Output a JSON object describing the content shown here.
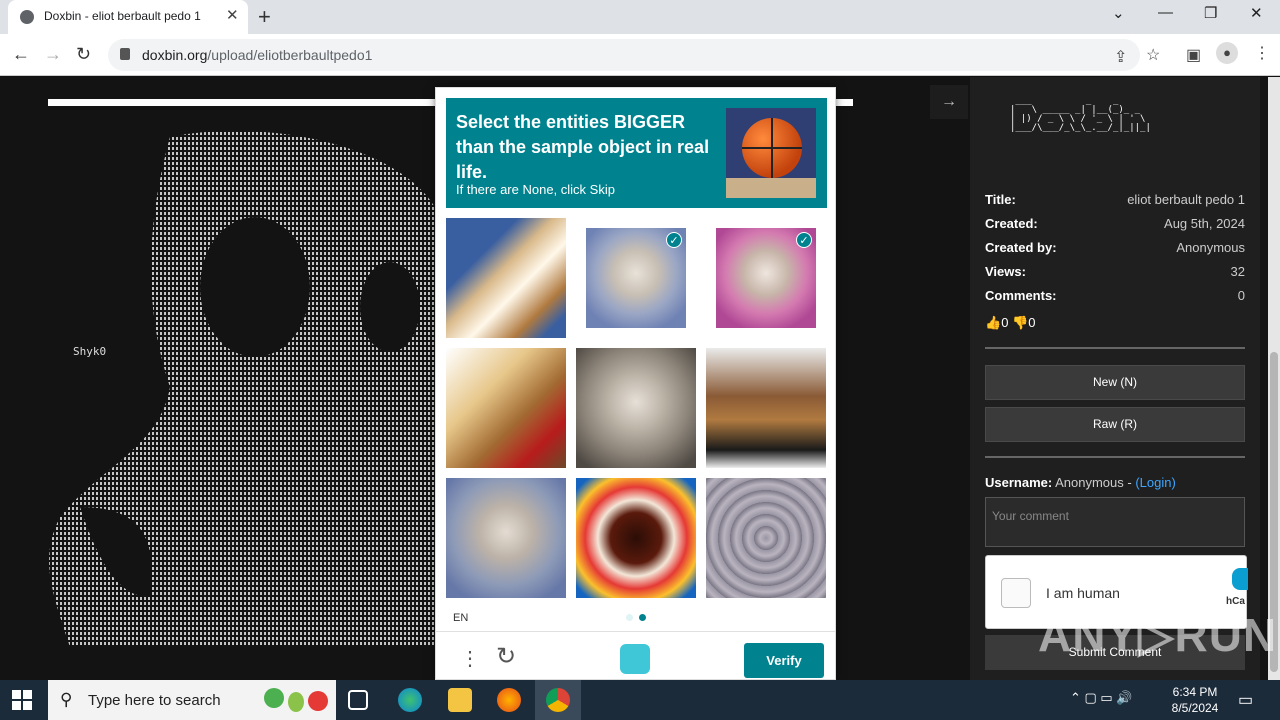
{
  "browser": {
    "tab_title": "Doxbin - eliot berbault pedo 1",
    "tab_close": "✕",
    "new_tab": "+",
    "window_controls": [
      "⌄",
      "—",
      "❐",
      "✕"
    ],
    "nav": {
      "back": "←",
      "forward": "→",
      "reload": "↻"
    },
    "url_host": "doxbin.org",
    "url_path": "/upload/eliotberbaultpedo1",
    "toolbar_icons": [
      "share-icon",
      "star-icon",
      "sidebar-icon",
      "profile-icon",
      "menu-icon"
    ]
  },
  "page": {
    "ascii_label": "Shyk0",
    "collapse_arrow": "→"
  },
  "sidebar": {
    "logo_ascii": " ___          _    _     \n|   \\ _____ _| |__(_)_ _ \n| |) / _ \\ \\ / '_ \\ | ' \\\n|___/\\___/_\\_\\_.__/_|_||_|",
    "meta": [
      {
        "key": "Title:",
        "value": "eliot berbault pedo 1"
      },
      {
        "key": "Created:",
        "value": "Aug 5th, 2024"
      },
      {
        "key": "Created by:",
        "value": "Anonymous"
      },
      {
        "key": "Views:",
        "value": "32"
      },
      {
        "key": "Comments:",
        "value": "0"
      }
    ],
    "likes": "0",
    "dislikes": "0",
    "new_button": "New (N)",
    "raw_button": "Raw (R)",
    "username_label": "Username:",
    "username_value": "Anonymous -",
    "login_link": "(Login)",
    "comment_placeholder": "Your comment",
    "captcha_label": "I am human",
    "captcha_brand": "hCa",
    "submit_button": "Submit Comment"
  },
  "challenge": {
    "prompt": "Select the entities BIGGER than the sample object in real life.",
    "sub_prompt": "If there are None, click Skip",
    "tiles": [
      {
        "name": "paintbrush",
        "selected": false
      },
      {
        "name": "sheep",
        "selected": true
      },
      {
        "name": "sheep",
        "selected": true
      },
      {
        "name": "paintbrush",
        "selected": false
      },
      {
        "name": "sheep",
        "selected": false
      },
      {
        "name": "paintbrush",
        "selected": false
      },
      {
        "name": "sheep",
        "selected": false
      },
      {
        "name": "cup",
        "selected": false
      },
      {
        "name": "sheep",
        "selected": false
      }
    ],
    "language": "EN",
    "page_indicator": {
      "current": 2,
      "total": 2
    },
    "verify_button": "Verify",
    "menu_icon": "⋮",
    "refresh_icon": "↻",
    "accent_color": "#00838f"
  },
  "taskbar": {
    "search_placeholder": "Type here to search",
    "time": "6:34 PM",
    "date": "8/5/2024"
  },
  "watermark": "ANY▷RUN"
}
